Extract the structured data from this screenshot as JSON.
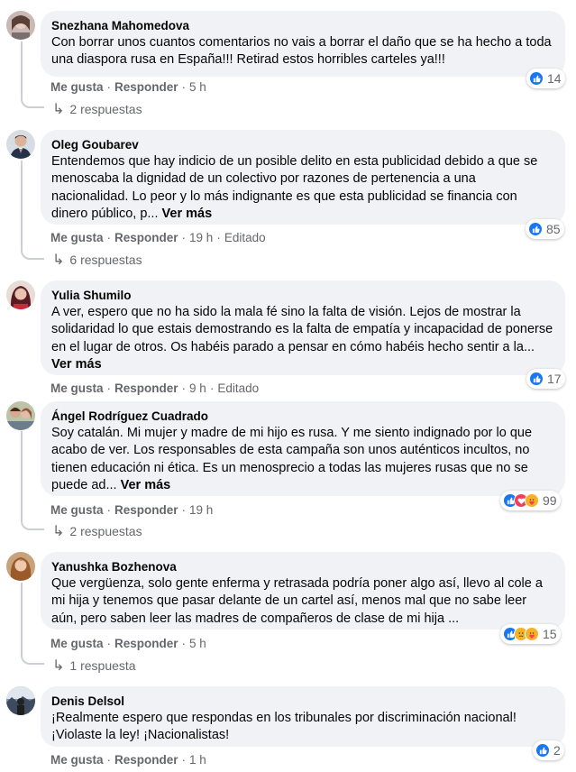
{
  "labels": {
    "like": "Me gusta",
    "reply": "Responder",
    "see_more": "Ver más",
    "sep": "·"
  },
  "comments": [
    {
      "author": "Snezhana Mahomedova",
      "text": "Con borrar unos cuantos comentarios no vais a borrar el daño que se ha hecho a toda una diaspora rusa en España!!! Retirad estos horribles carteles ya!!!",
      "time": "5 h",
      "edited": "",
      "reactions": [
        "like"
      ],
      "reaction_count": "14",
      "replies": "2 respuestas"
    },
    {
      "author": "Oleg Goubarev",
      "text": "Entendemos que hay indicio de un posible delito en esta publicidad debido a que se menoscaba la dignidad de un colectivo por razones de pertenencia a una nacionalidad. Lo peor y lo más indignante es que esta publicidad se financia con dinero público, p...",
      "time": "19 h",
      "edited": "Editado",
      "reactions": [
        "like"
      ],
      "reaction_count": "85",
      "replies": "6 respuestas"
    },
    {
      "author": "Yulia Shumilo",
      "text": "A ver, espero que no ha sido la mala fé sino la falta de visión. Lejos de mostrar la solidaridad lo que estais demostrando es la falta de empatía y incapacidad de ponerse en el lugar de otros. Os habéis parado a pensar en cómo habéis hecho sentir a la...",
      "time": "9 h",
      "edited": "Editado",
      "reactions": [
        "like"
      ],
      "reaction_count": "17",
      "replies": ""
    },
    {
      "author": "Ángel Rodríguez Cuadrado",
      "text": "Soy catalán. Mi mujer y madre de mi hijo es rusa. Y me siento indignado por lo que acabo de ver. Los responsables de esta campaña son unos auténticos incultos, no tienen educación ni ética. Es un menosprecio a todas las mujeres rusas que no se puede ad...",
      "time": "19 h",
      "edited": "",
      "reactions": [
        "like",
        "love",
        "care"
      ],
      "reaction_count": "99",
      "replies": "2 respuestas"
    },
    {
      "author": "Yanushka Bozhenova",
      "text": "Que vergüenza, solo gente enferma y retrasada podría poner algo así, llevo al cole a mi hija y tenemos que pasar delante de un cartel así, menos mal que no sabe leer aún, pero saben leer las madres de compañeros de clase de mi hija ...",
      "time": "5 h",
      "edited": "",
      "reactions": [
        "like",
        "sad",
        "care"
      ],
      "reaction_count": "15",
      "replies": "1 respuesta"
    },
    {
      "author": "Denis Delsol",
      "text": "¡Realmente espero que respondas en los tribunales por discriminación nacional! ¡Violaste la ley! ¡Nacionalistas!",
      "time": "1 h",
      "edited": "",
      "reactions": [
        "like"
      ],
      "reaction_count": "2",
      "replies": ""
    }
  ],
  "colors": {
    "like": "#1877f2",
    "love": "#f33e58",
    "care": "#f7b125",
    "sad": "#f7b125",
    "meta": "#65676b",
    "bubble": "#f0f2f5"
  }
}
